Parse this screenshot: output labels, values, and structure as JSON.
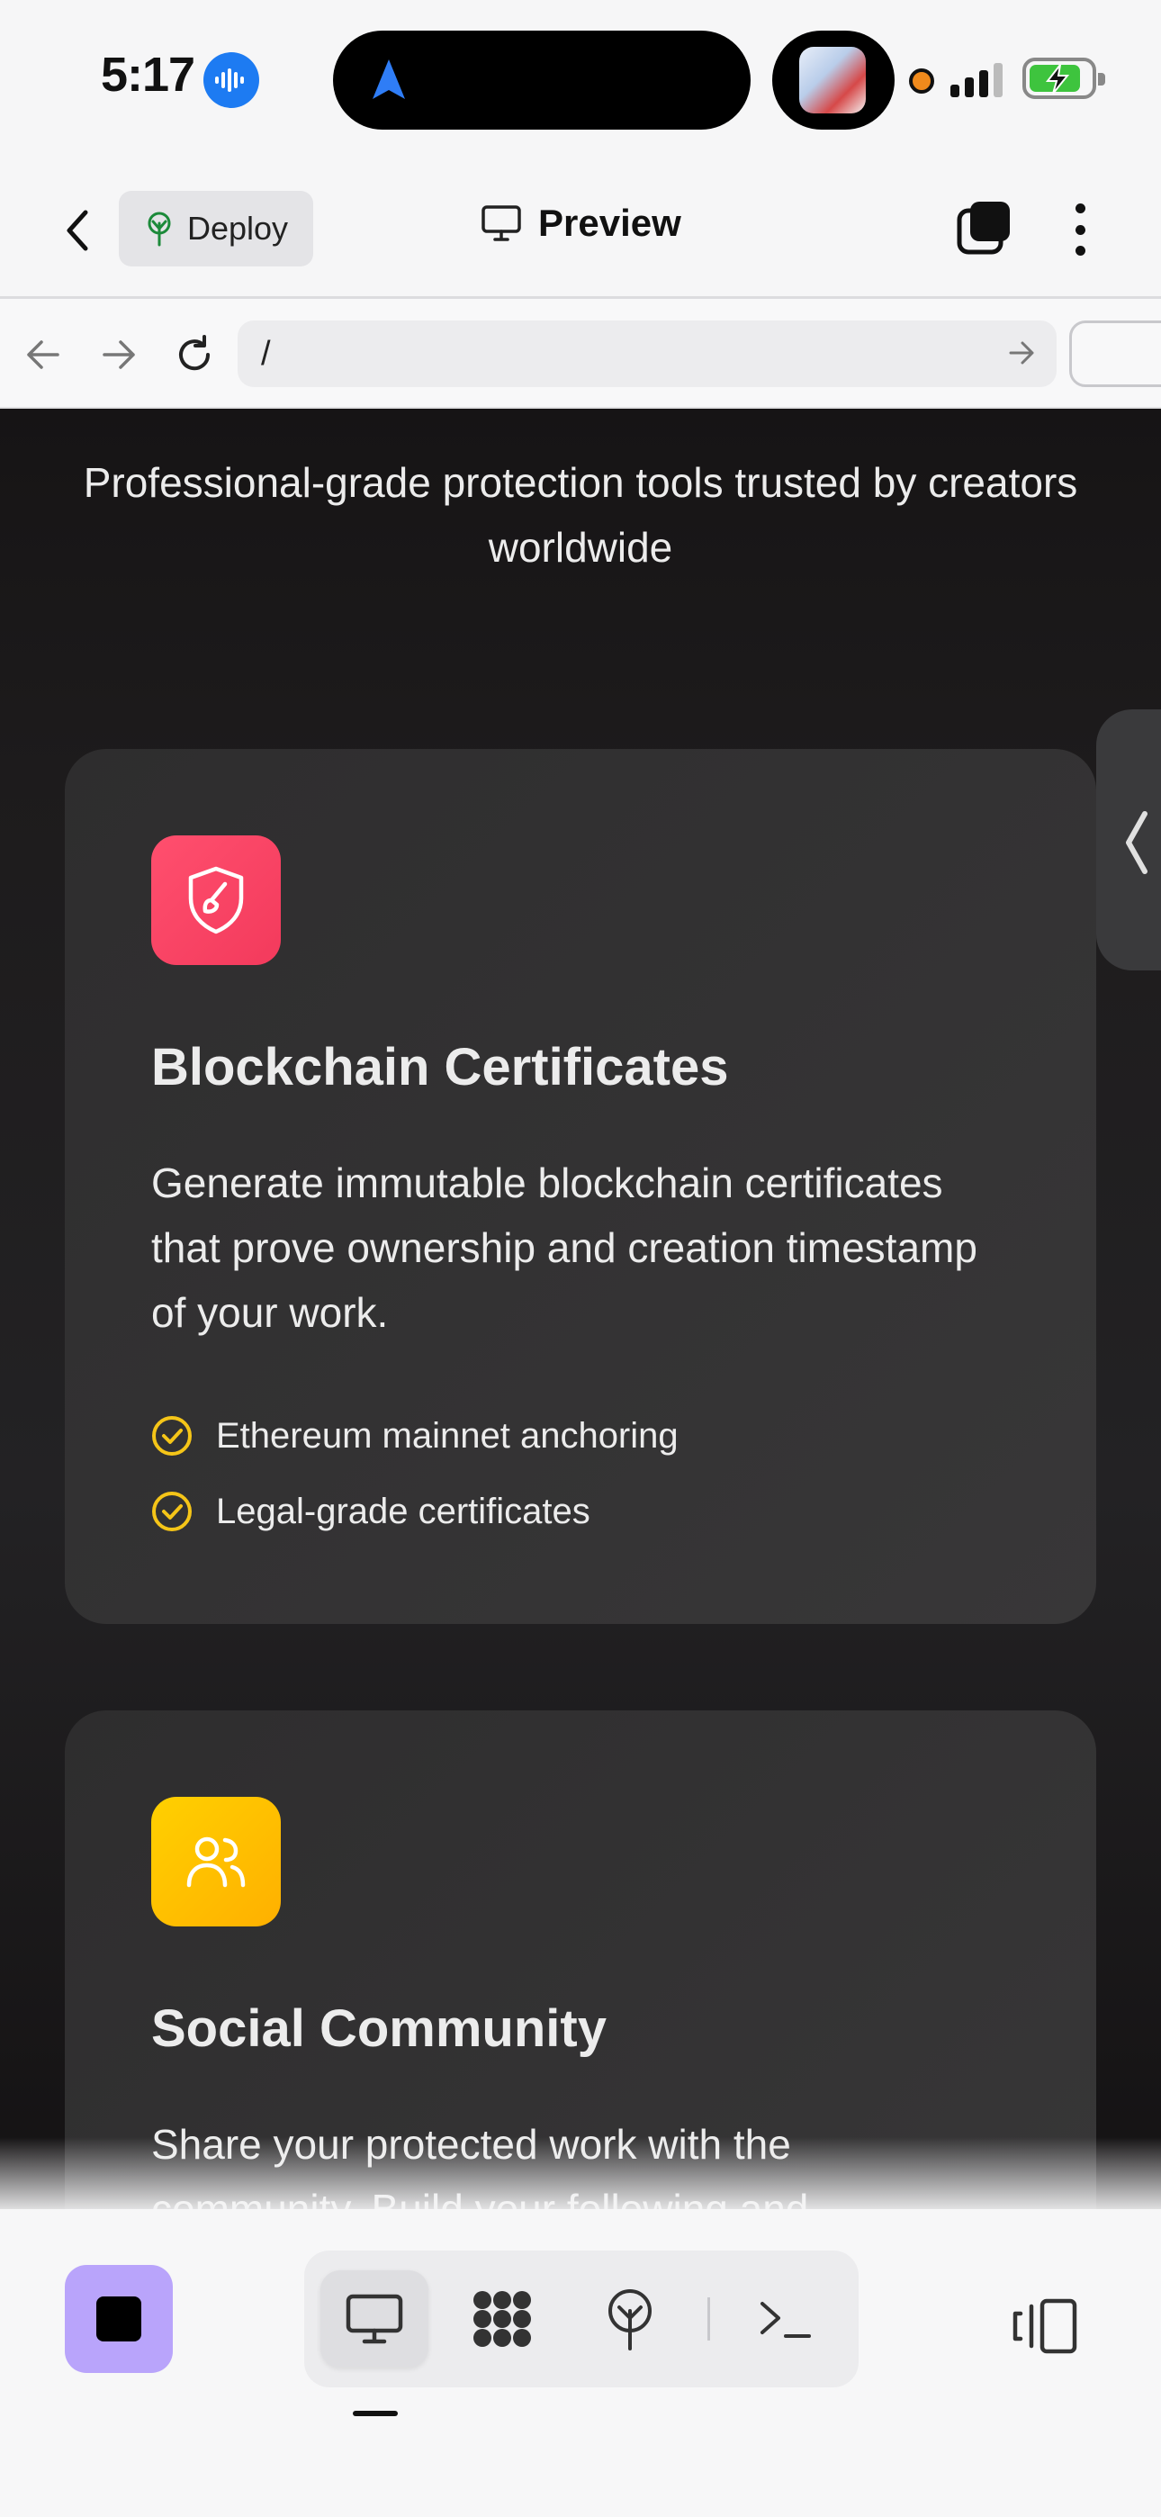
{
  "status_bar": {
    "time": "5:17"
  },
  "header": {
    "deploy_label": "Deploy",
    "title": "Preview"
  },
  "browser": {
    "url": "/"
  },
  "page": {
    "subtitle": "Professional-grade protection tools trusted by creators worldwide",
    "cards": [
      {
        "icon": "shield-brush-icon",
        "title": "Blockchain Certificates",
        "description": "Generate immutable blockchain certificates that prove ownership and creation timestamp of your work.",
        "features": [
          "Ethereum mainnet anchoring",
          "Legal-grade certificates"
        ]
      },
      {
        "icon": "users-icon",
        "title": "Social Community",
        "description": "Share your protected work with the community. Build your following and"
      }
    ]
  },
  "colors": {
    "accent_purple": "#b9a4fb",
    "card_red": "#ff4f6e",
    "card_yellow": "#ffc400",
    "check_yellow": "#f5c518"
  }
}
